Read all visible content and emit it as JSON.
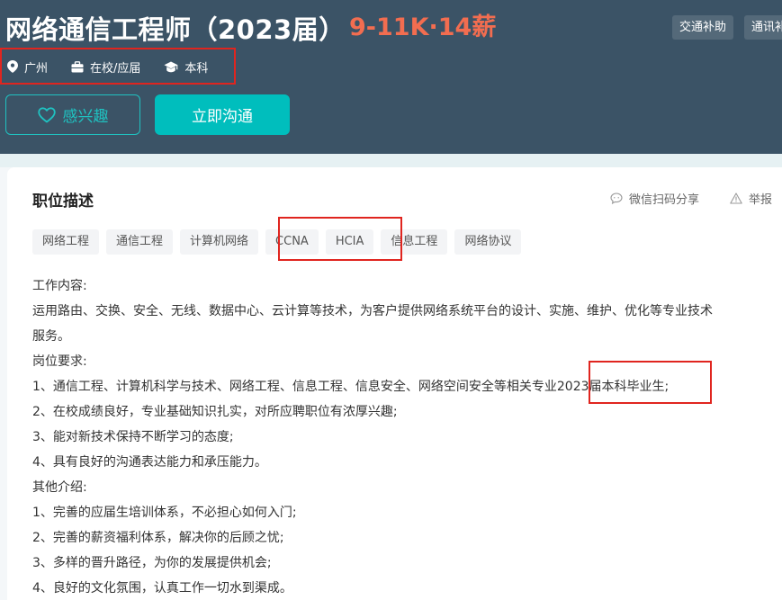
{
  "job": {
    "title": "网络通信工程师（2023届）",
    "salary": "9-11K·14薪",
    "top_tags": [
      "交通补助",
      "通讯补"
    ],
    "meta": {
      "location": "广州",
      "experience": "在校/应届",
      "education": "本科"
    }
  },
  "actions": {
    "like_label": "感兴趣",
    "chat_label": "立即沟通"
  },
  "section": {
    "title": "职位描述",
    "share_label": "微信扫码分享",
    "report_label": "举报"
  },
  "skills": [
    "网络工程",
    "通信工程",
    "计算机网络",
    "CCNA",
    "HCIA",
    "信息工程",
    "网络协议"
  ],
  "description": [
    "工作内容:",
    "运用路由、交换、安全、无线、数据中心、云计算等技术，为客户提供网络系统平台的设计、实施、维护、优化等专业技术",
    "服务。",
    "岗位要求:",
    "1、通信工程、计算机科学与技术、网络工程、信息工程、信息安全、网络空间安全等相关专业2023届本科毕业生;",
    "2、在校成绩良好，专业基础知识扎实，对所应聘职位有浓厚兴趣;",
    "3、能对新技术保持不断学习的态度;",
    "4、具有良好的沟通表达能力和承压能力。",
    "其他介绍:",
    "1、完善的应届生培训体系，不必担心如何入门;",
    "2、完善的薪资福利体系，解决你的后顾之忧;",
    "3、多样的晋升路径，为你的发展提供机会;",
    "4、良好的文化氛围，认真工作一切水到渠成。"
  ],
  "colors": {
    "header_bg": "#3b5366",
    "salary": "#f26d50",
    "accent": "#00bebd",
    "highlight_box": "#e0251f"
  }
}
